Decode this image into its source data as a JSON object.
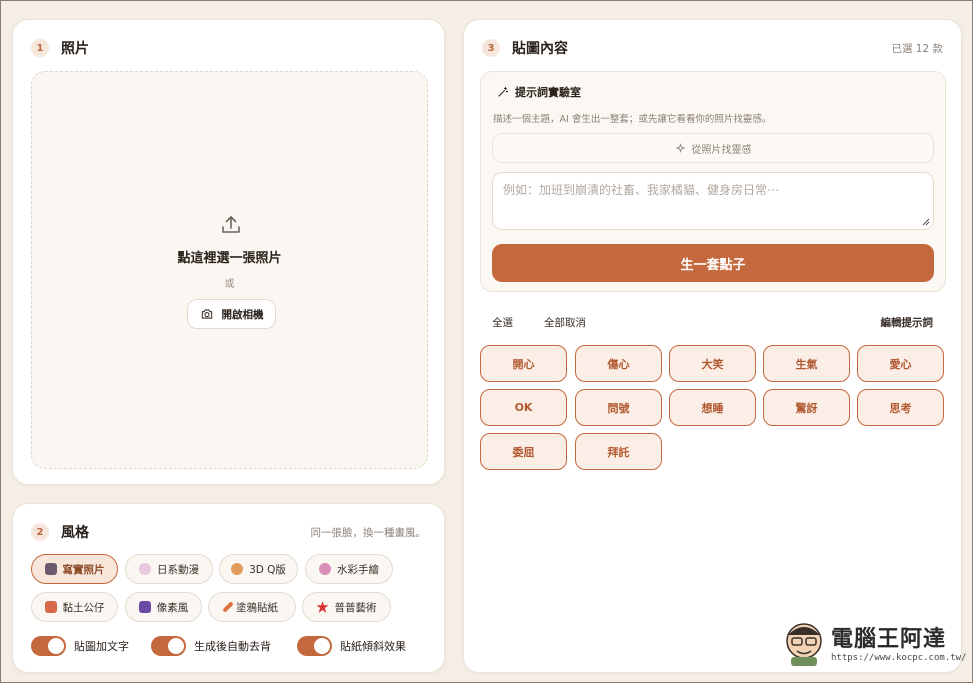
{
  "photo": {
    "step": "1",
    "title": "照片",
    "drop_title": "點這裡選一張照片",
    "or_text": "或",
    "camera_label": "開啟相機"
  },
  "style": {
    "step": "2",
    "title": "風格",
    "hint": "同一張臉，換一種畫風。",
    "chips": [
      {
        "label": "寫實照片",
        "icon": "camera-photo-icon",
        "active": true
      },
      {
        "label": "日系動漫",
        "icon": "sparkle-anime-icon",
        "active": false
      },
      {
        "label": "3D Q版",
        "icon": "figure-3d-icon",
        "active": false
      },
      {
        "label": "水彩手繪",
        "icon": "palette-icon",
        "active": false
      },
      {
        "label": "黏土公仔",
        "icon": "clay-block-icon",
        "active": false
      },
      {
        "label": "像素風",
        "icon": "pixel-invader-icon",
        "active": false
      },
      {
        "label": "塗鴉貼紙",
        "icon": "pencil-icon",
        "active": false
      },
      {
        "label": "普普藝術",
        "icon": "pop-burst-icon",
        "active": false
      }
    ],
    "toggles": [
      {
        "label": "貼圖加文字",
        "on": true
      },
      {
        "label": "生成後自動去背",
        "on": true
      },
      {
        "label": "貼紙傾斜效果",
        "on": true
      }
    ]
  },
  "content": {
    "step": "3",
    "title": "貼圖內容",
    "selected_count": "已選 12 款",
    "lab_title": "提示詞實驗室",
    "lab_desc": "描述一個主題，AI 會生出一整套；或先讓它看看你的照片找靈感。",
    "inspire_label": "從照片找靈感",
    "idea_placeholder": "例如：加班到崩潰的社畜、我家橘貓、健身房日常⋯",
    "generate_label": "生一套點子",
    "select_all": "全選",
    "deselect_all": "全部取消",
    "edit_prompts": "編輯提示詞",
    "stickers": [
      "開心",
      "傷心",
      "大笑",
      "生氣",
      "愛心",
      "OK",
      "問號",
      "想睡",
      "驚訝",
      "思考",
      "委屈",
      "拜託"
    ]
  },
  "watermark": {
    "brand": "電腦王阿達",
    "url": "https://www.kocpc.com.tw/"
  },
  "colors": {
    "accent": "#c4683d",
    "background": "#f4eee6",
    "card": "#ffffff"
  }
}
